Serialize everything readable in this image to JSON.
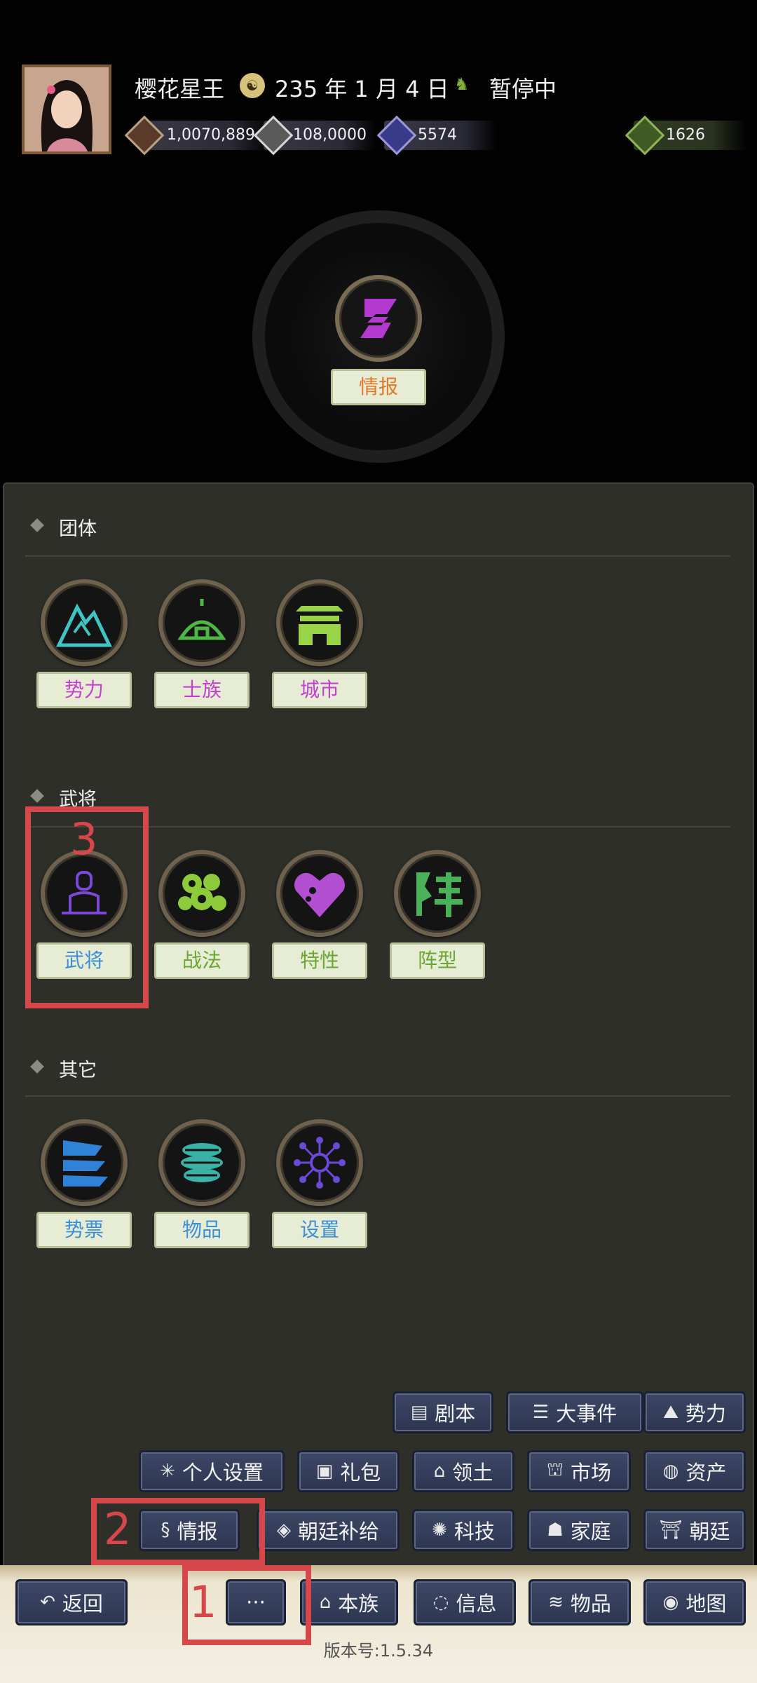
{
  "header": {
    "player_name": "樱花星王",
    "game_date": "235 年 1 月 4 日",
    "status": "暂停中",
    "resources": {
      "gold": "1,0070,889",
      "food": "108,0000",
      "troops": "5574",
      "potion": "1626"
    }
  },
  "emblem": {
    "label": "情报"
  },
  "sections": {
    "group": {
      "title": "团体",
      "items": [
        {
          "label": "势力",
          "color": "#c540d0",
          "icon": "mountain-icon"
        },
        {
          "label": "士族",
          "color": "#c540d0",
          "icon": "tent-icon"
        },
        {
          "label": "城市",
          "color": "#c540d0",
          "icon": "city-gate-icon"
        }
      ]
    },
    "generals": {
      "title": "武将",
      "items": [
        {
          "label": "武将",
          "color": "#3c8fd6",
          "icon": "meditating-general-icon"
        },
        {
          "label": "战法",
          "color": "#6aa634",
          "icon": "bubbles-icon"
        },
        {
          "label": "特性",
          "color": "#6aa634",
          "icon": "heart-icon"
        },
        {
          "label": "阵型",
          "color": "#6aa634",
          "icon": "formation-glyph-icon"
        }
      ]
    },
    "other": {
      "title": "其它",
      "items": [
        {
          "label": "势票",
          "color": "#3c8fd6",
          "icon": "sail-icon"
        },
        {
          "label": "物品",
          "color": "#3c8fd6",
          "icon": "scroll-bundle-icon"
        },
        {
          "label": "设置",
          "color": "#3c8fd6",
          "icon": "network-icon"
        }
      ]
    }
  },
  "menu": {
    "row1": [
      "剧本",
      "大事件",
      "势力"
    ],
    "row2": [
      "个人设置",
      "礼包",
      "领土",
      "市场",
      "资产"
    ],
    "row3": [
      "情报",
      "朝廷补给",
      "科技",
      "家庭",
      "朝廷"
    ]
  },
  "nav": {
    "back": "返回",
    "more": "···",
    "clan": "本族",
    "info": "信息",
    "items": "物品",
    "map": "地图"
  },
  "version": "版本号:1.5.34",
  "annotations": {
    "n1": "1",
    "n2": "2",
    "n3": "3"
  },
  "colors": {
    "annotation_red": "#d6474b",
    "panel_bg": "#2f2f2a",
    "button_blue": "#3d4866"
  }
}
